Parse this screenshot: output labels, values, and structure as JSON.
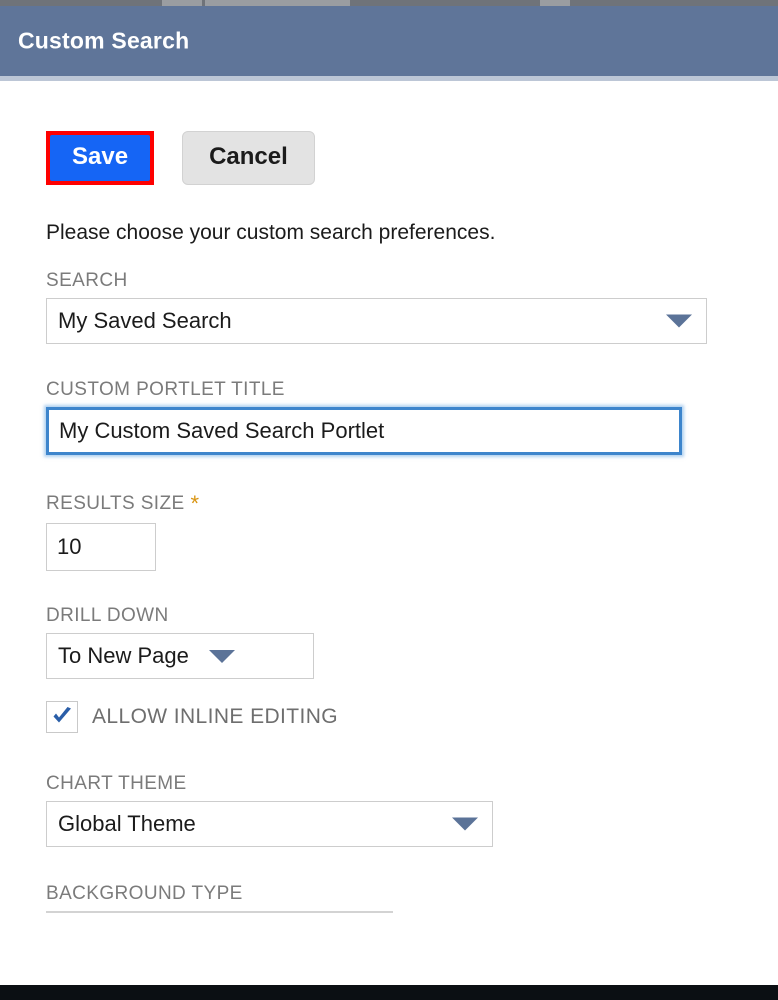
{
  "window": {
    "title": "Custom Search"
  },
  "toolbar": {
    "save_label": "Save",
    "cancel_label": "Cancel"
  },
  "body": {
    "intro_text": "Please choose your custom search preferences."
  },
  "fields": {
    "search": {
      "label": "SEARCH",
      "value": "My Saved Search",
      "type": "select"
    },
    "custom_portlet_title": {
      "label": "CUSTOM PORTLET TITLE",
      "value": "My Custom Saved Search Portlet",
      "placeholder": "",
      "type": "text",
      "focused": true
    },
    "results_size": {
      "label": "RESULTS SIZE",
      "required_marker": "*",
      "value": "10",
      "placeholder": "",
      "type": "text"
    },
    "drill_down": {
      "label": "DRILL DOWN",
      "value": "To New Page",
      "type": "select"
    },
    "allow_inline_editing": {
      "label": "ALLOW INLINE EDITING",
      "checked": true,
      "type": "checkbox"
    },
    "chart_theme": {
      "label": "CHART THEME",
      "value": "Global Theme",
      "type": "select"
    },
    "background_type": {
      "label": "BACKGROUND TYPE",
      "type": "select"
    }
  },
  "colors": {
    "header_bg": "#5f7599",
    "header_underline": "#bcc6d6",
    "save_bg": "#1565f5",
    "save_highlight": "#fe0000",
    "cancel_bg": "#e3e3e3",
    "label_gray": "#7b7b7b",
    "required_orange": "#d99411",
    "caret_blue": "#5b7398",
    "focus_blue": "#3d85cc",
    "check_blue": "#2a5ea8",
    "bottom_bar": "#0b0f13"
  }
}
